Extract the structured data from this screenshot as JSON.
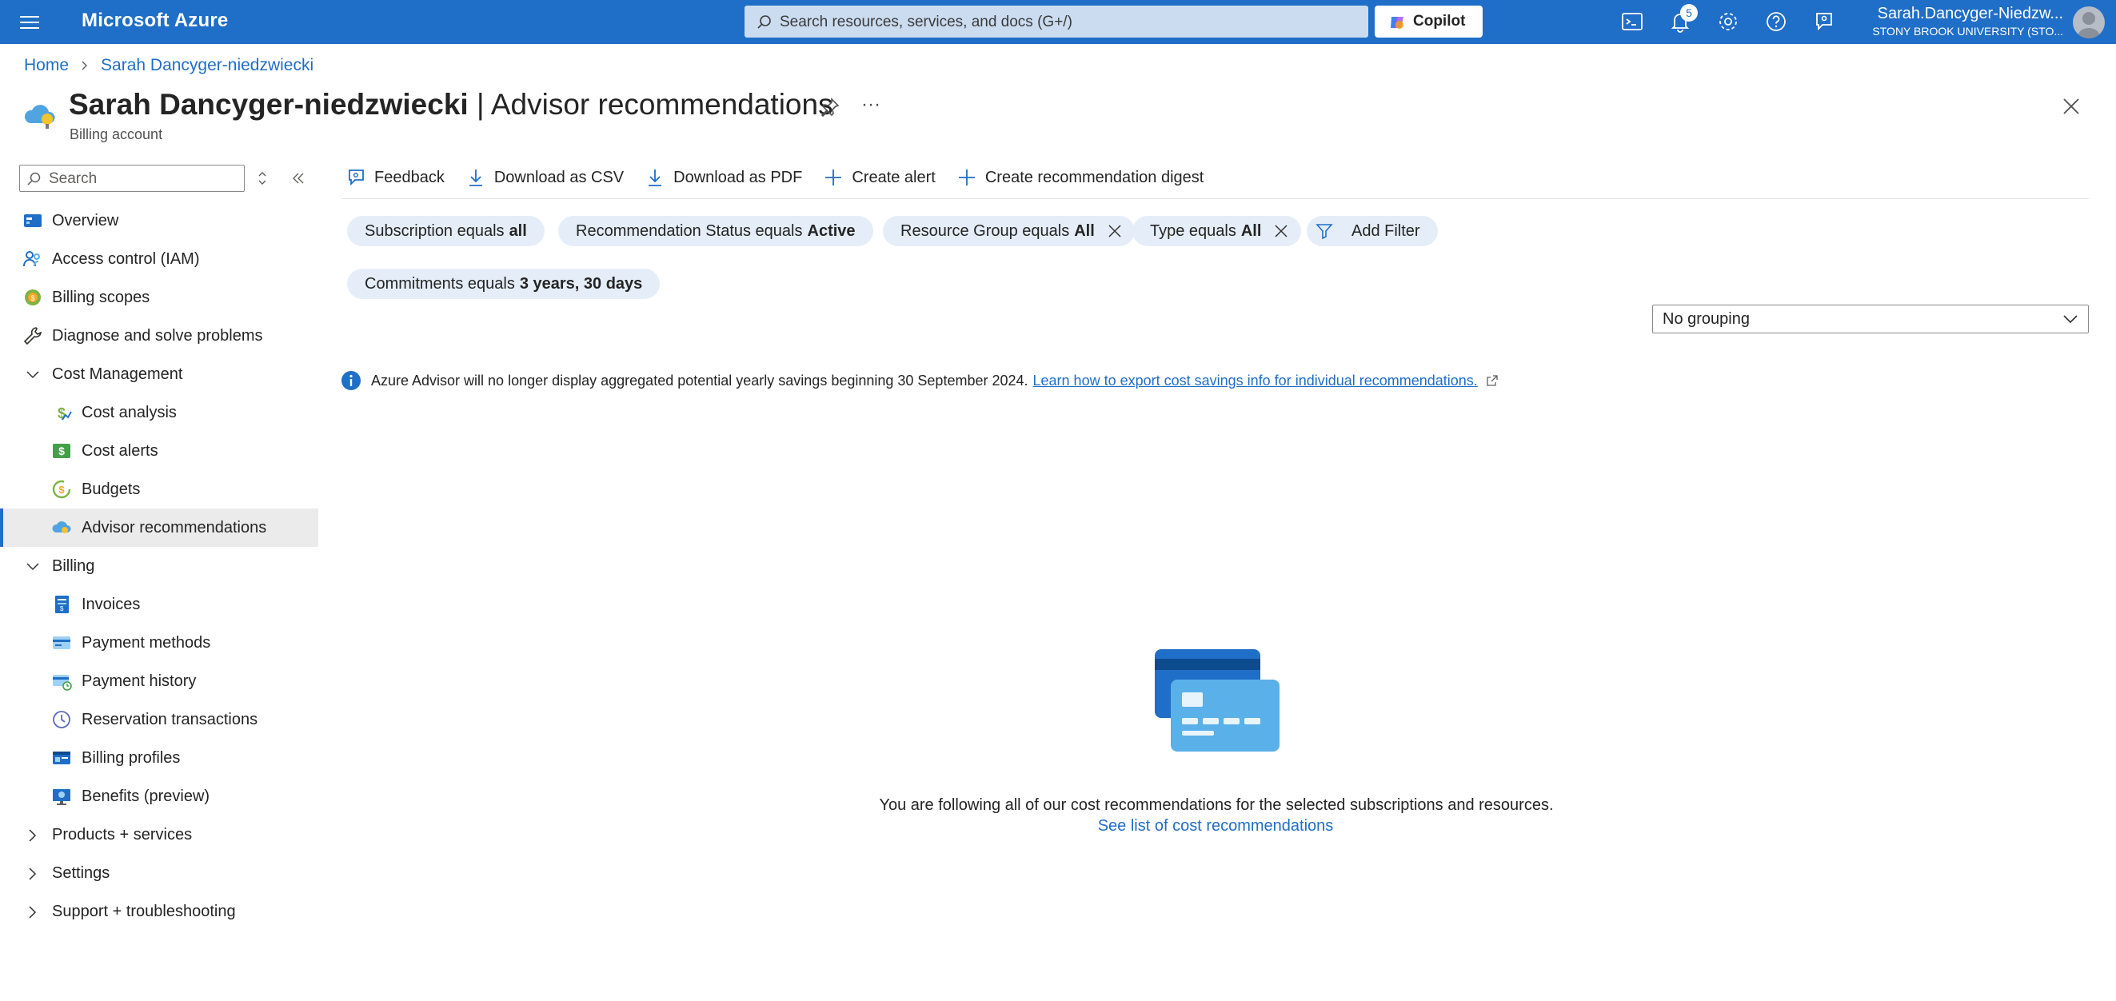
{
  "topbar": {
    "brand": "Microsoft Azure",
    "search_placeholder": "Search resources, services, and docs (G+/)",
    "copilot_label": "Copilot",
    "notification_count": "5",
    "account_name": "Sarah.Dancyger-Niedzw...",
    "account_org": "STONY BROOK UNIVERSITY (STO..."
  },
  "breadcrumb": {
    "home": "Home",
    "current": "Sarah Dancyger-niedzwiecki"
  },
  "header": {
    "title_account": "Sarah Dancyger-niedzwiecki",
    "title_separator": " | ",
    "title_page": "Advisor recommendations",
    "subtitle": "Billing account",
    "more": "···"
  },
  "sidebar": {
    "search_placeholder": "Search",
    "items": [
      {
        "label": "Overview"
      },
      {
        "label": "Access control (IAM)"
      },
      {
        "label": "Billing scopes"
      },
      {
        "label": "Diagnose and solve problems"
      },
      {
        "label": "Cost Management"
      },
      {
        "label": "Cost analysis"
      },
      {
        "label": "Cost alerts"
      },
      {
        "label": "Budgets"
      },
      {
        "label": "Advisor recommendations"
      },
      {
        "label": "Billing"
      },
      {
        "label": "Invoices"
      },
      {
        "label": "Payment methods"
      },
      {
        "label": "Payment history"
      },
      {
        "label": "Reservation transactions"
      },
      {
        "label": "Billing profiles"
      },
      {
        "label": "Benefits (preview)"
      },
      {
        "label": "Products + services"
      },
      {
        "label": "Settings"
      },
      {
        "label": "Support + troubleshooting"
      }
    ]
  },
  "toolbar": {
    "feedback": "Feedback",
    "download_csv": "Download as CSV",
    "download_pdf": "Download as PDF",
    "create_alert": "Create alert",
    "create_digest": "Create recommendation digest"
  },
  "filters": {
    "subscription": {
      "label": "Subscription equals",
      "value": "all"
    },
    "status": {
      "label": "Recommendation Status equals",
      "value": "Active"
    },
    "resource_group": {
      "label": "Resource Group equals",
      "value": "All"
    },
    "type": {
      "label": "Type equals",
      "value": "All"
    },
    "add_filter": "Add Filter",
    "commitments": {
      "label": "Commitments equals",
      "value": "3 years, 30 days"
    }
  },
  "grouping": {
    "selected": "No grouping"
  },
  "info": {
    "text": "Azure Advisor will no longer display aggregated potential yearly savings beginning 30 September 2024.",
    "link": "Learn how to export cost savings info for individual recommendations."
  },
  "empty_state": {
    "message": "You are following all of our cost recommendations for the selected subscriptions and resources.",
    "link": "See list of cost recommendations"
  },
  "colors": {
    "accent": "#1f6ec7",
    "pill_bg": "#e5eef8",
    "active_nav_bg": "#ebebeb"
  }
}
